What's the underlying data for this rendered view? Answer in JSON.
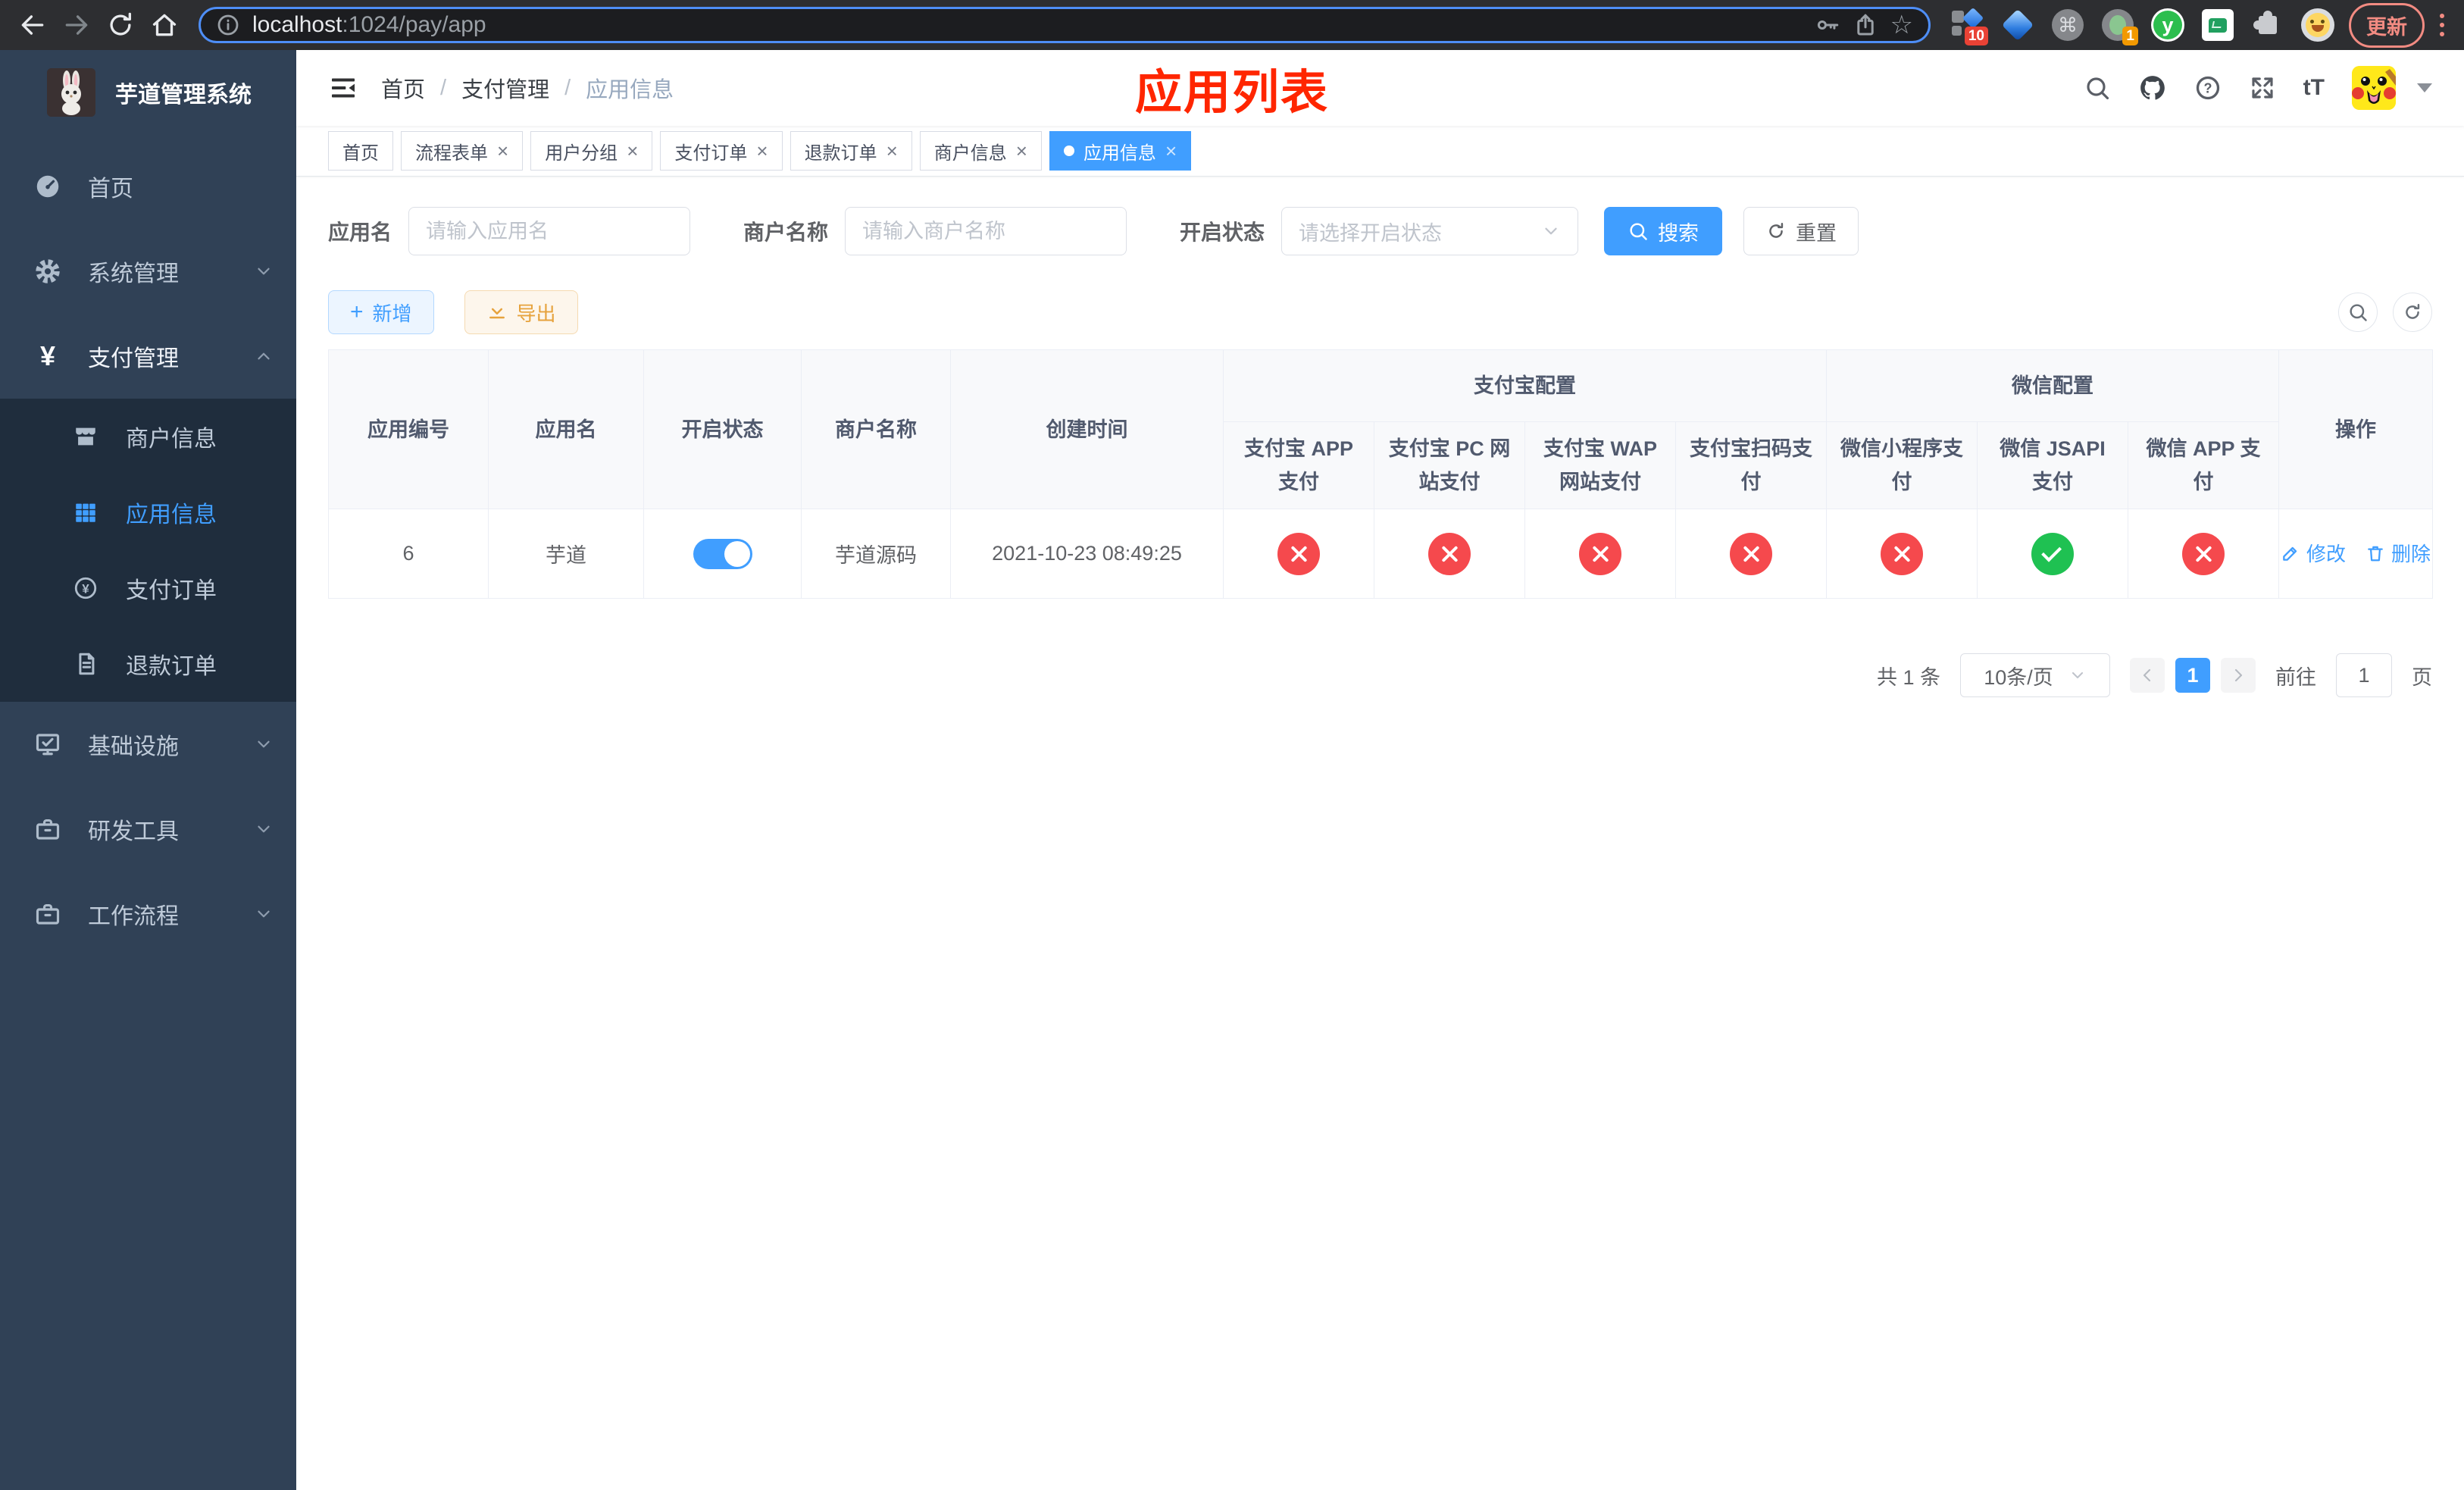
{
  "colors": {
    "accent": "#409eff",
    "success": "#1fc152",
    "danger": "#f5494d",
    "warning": "#e6a23c",
    "overlay_title": "#ff2600",
    "sidebar_bg": "#304156",
    "sidebar_submenu_bg": "#1f2d3d",
    "chrome_bg": "#2d2e31",
    "update_red": "#f28b82"
  },
  "ui": {
    "close": "×",
    "slash": "/",
    "plus": "+",
    "yen": "¥",
    "question": "?",
    "command": "⌘",
    "star": "☆",
    "font_size": "tT",
    "letter_y": "y"
  },
  "browser": {
    "url_host": "localhost",
    "url_path": ":1024/pay/app",
    "extension_badge_grid": "10",
    "extension_badge_circle": "1",
    "update_label": "更新"
  },
  "sidebar": {
    "logo_title": "芋道管理系统",
    "menu_home": "首页",
    "menu_system": "系统管理",
    "menu_pay": "支付管理",
    "sub_merchant": "商户信息",
    "sub_app": "应用信息",
    "sub_pay_order": "支付订单",
    "sub_refund_order": "退款订单",
    "menu_infra": "基础设施",
    "menu_devtools": "研发工具",
    "menu_workflow": "工作流程"
  },
  "navbar": {
    "breadcrumb": [
      "首页",
      "支付管理",
      "应用信息"
    ]
  },
  "overlay_title": "应用列表",
  "tabs": [
    {
      "label": "首页"
    },
    {
      "label": "流程表单"
    },
    {
      "label": "用户分组"
    },
    {
      "label": "支付订单"
    },
    {
      "label": "退款订单"
    },
    {
      "label": "商户信息"
    },
    {
      "label": "应用信息"
    }
  ],
  "filters": {
    "app_name_label": "应用名",
    "app_name_placeholder": "请输入应用名",
    "merchant_label": "商户名称",
    "merchant_placeholder": "请输入商户名称",
    "status_label": "开启状态",
    "status_placeholder": "请选择开启状态",
    "search_label": "搜索",
    "reset_label": "重置"
  },
  "toolbar": {
    "add_label": "新增",
    "export_label": "导出"
  },
  "table": {
    "col_app_id": "应用编号",
    "col_app_name": "应用名",
    "col_status": "开启状态",
    "col_merchant": "商户名称",
    "col_create_time": "创建时间",
    "group_alipay": "支付宝配置",
    "group_wechat": "微信配置",
    "col_alipay_app": "支付宝 APP 支付",
    "col_alipay_pc": "支付宝 PC 网站支付",
    "col_alipay_wap": "支付宝 WAP 网站支付",
    "col_alipay_qr": "支付宝扫码支付",
    "col_wx_lite": "微信小程序支付",
    "col_wx_jsapi": "微信 JSAPI 支付",
    "col_wx_app": "微信 APP 支付",
    "col_actions": "操作",
    "rows": [
      {
        "app_id": "6",
        "app_name": "芋道",
        "status_on": true,
        "merchant_name": "芋道源码",
        "create_time": "2021-10-23 08:49:25",
        "channels": [
          "no",
          "no",
          "no",
          "no",
          "no",
          "yes",
          "no"
        ],
        "edit_label": "修改",
        "delete_label": "删除"
      }
    ]
  },
  "pagination": {
    "total_text": "共 1 条",
    "page_size": "10条/页",
    "current_page": "1",
    "goto_label": "前往",
    "goto_value": "1",
    "page_suffix": "页"
  }
}
